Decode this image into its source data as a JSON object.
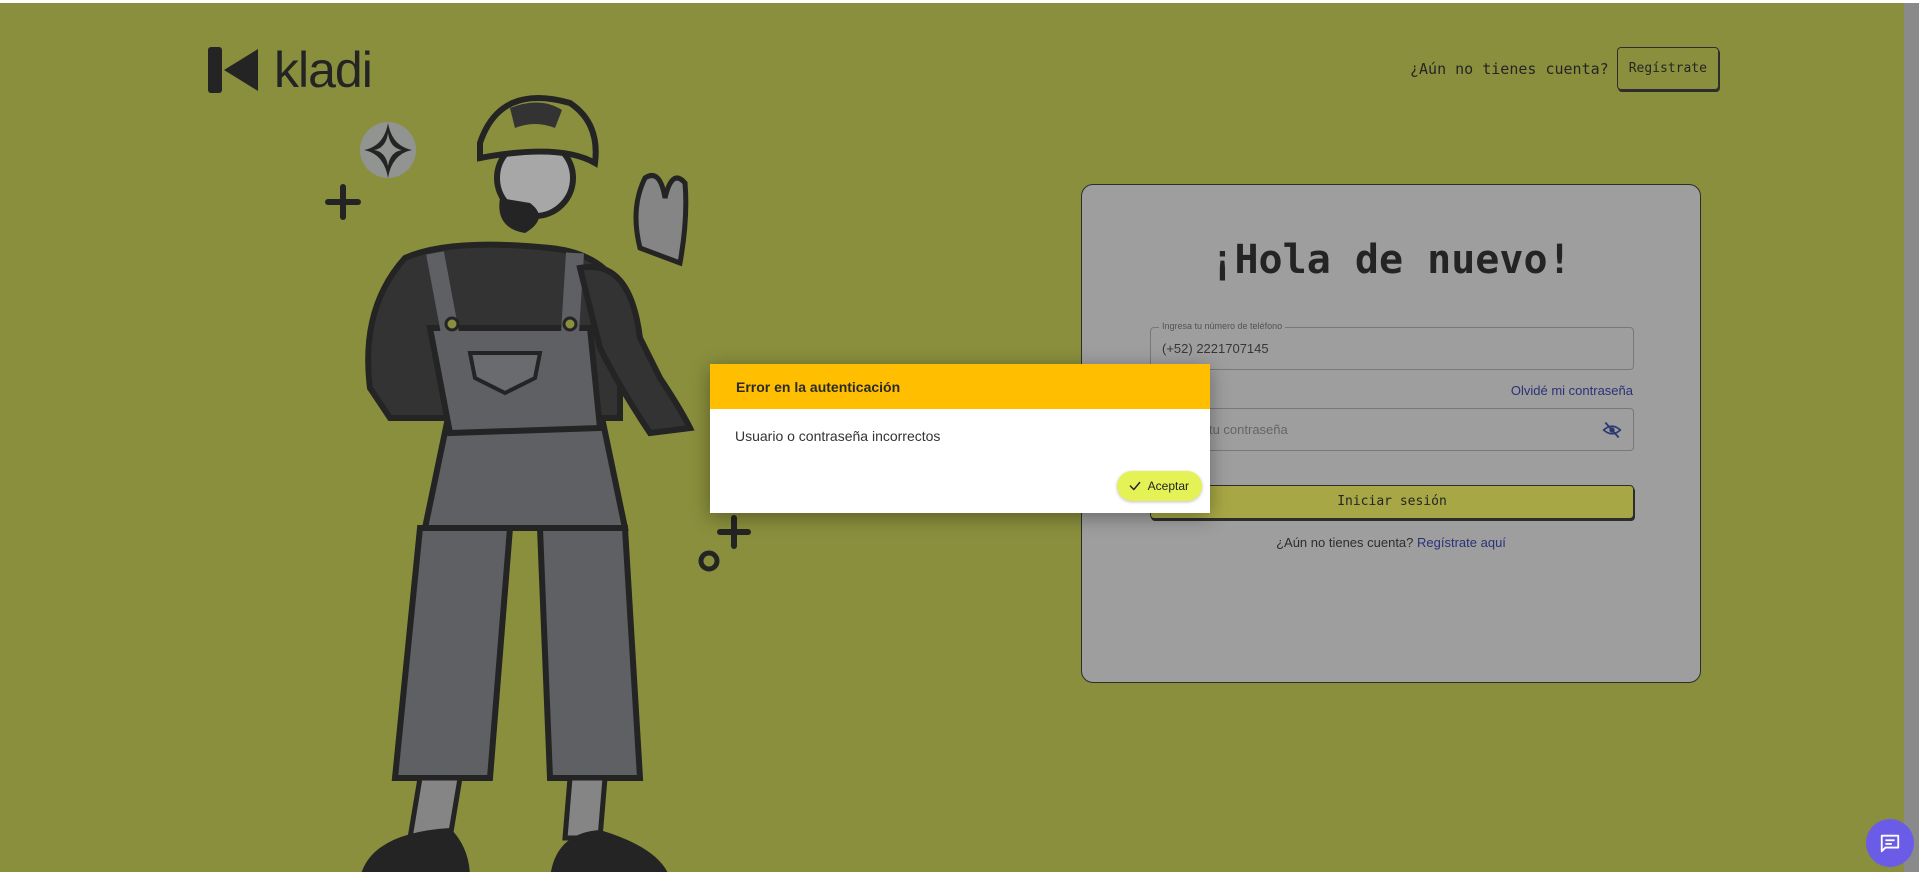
{
  "brand": {
    "name": "kladi"
  },
  "header": {
    "question": "¿Aún no tienes cuenta?",
    "register_label": "Regístrate"
  },
  "login": {
    "title": "¡Hola de nuevo!",
    "phone_legend": "Ingresa tu número de teléfono",
    "phone_value": "(+52) 2221707145",
    "forgot_label": "Olvidé mi contraseña",
    "password_placeholder": "Ingresa tu contraseña",
    "submit_label": "Iniciar sesión",
    "signup_question": "¿Aún no tienes cuenta?",
    "signup_link": "Regístrate aquí"
  },
  "dialog": {
    "title": "Error en la autenticación",
    "message": "Usuario o contraseña incorrectos",
    "accept_label": "Aceptar"
  },
  "colors": {
    "background": "#c9d43d",
    "dialog_header": "#ffbf00",
    "accept_button": "#e4f255",
    "link": "#1e2aa8",
    "chat_fab": "#6b5ce7"
  },
  "icons": [
    "kladi-logo-icon",
    "sparkle-icon",
    "plus-icon",
    "eye-off-icon",
    "check-icon",
    "chat-icon"
  ]
}
